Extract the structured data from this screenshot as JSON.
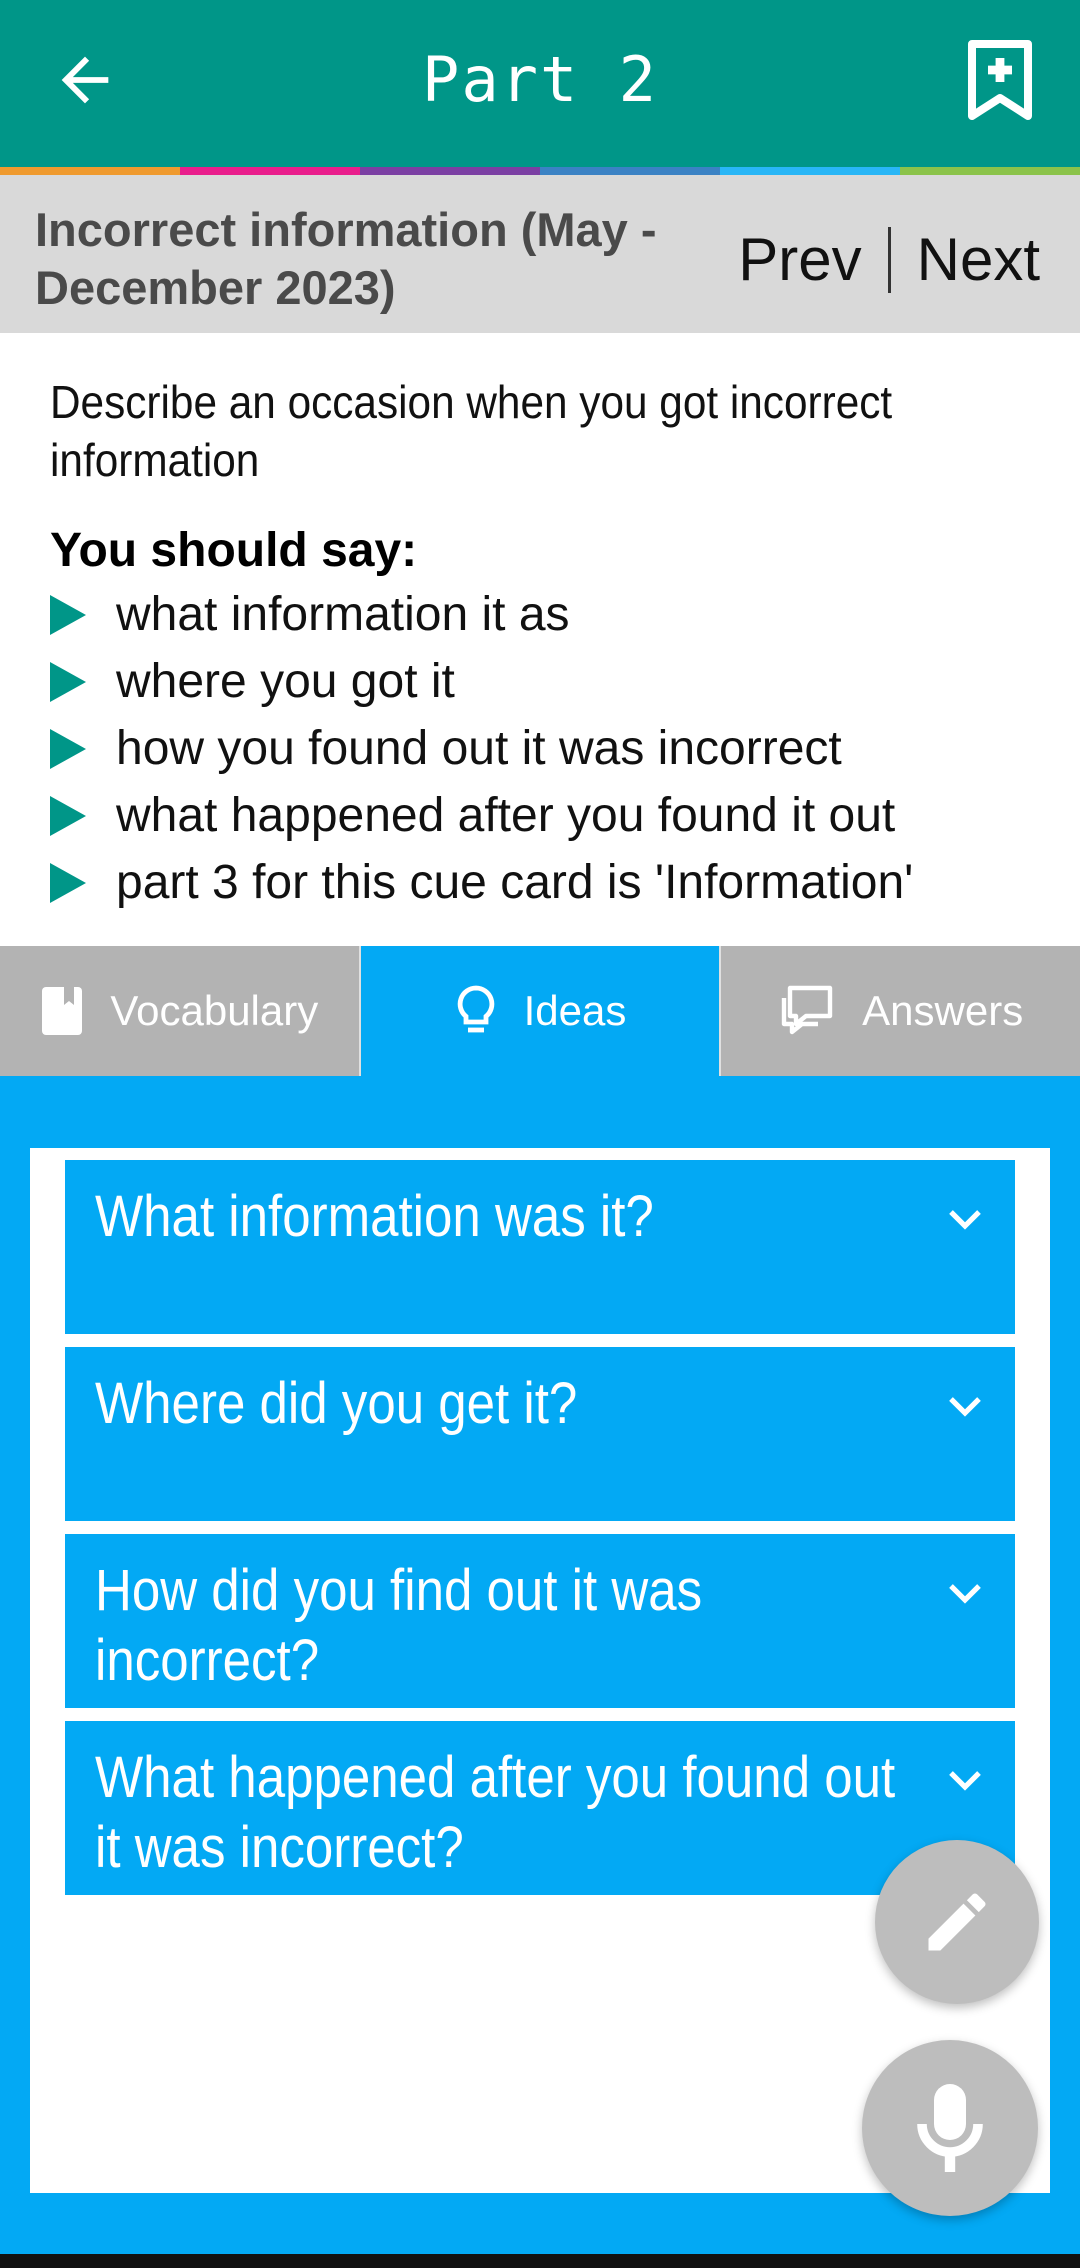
{
  "appbar": {
    "title": "Part 2",
    "back_icon": "arrow-left-icon",
    "bookmark_icon": "bookmark-add-icon",
    "bg_color": "#009688"
  },
  "color_strip": [
    "#ef9a2e",
    "#e91e8c",
    "#7b3fa3",
    "#3b82c4",
    "#29b6f6",
    "#8bc34a"
  ],
  "topic": {
    "title": "Incorrect information (May - December 2023)",
    "prev_label": "Prev",
    "next_label": "Next"
  },
  "cue_card": {
    "title": "Describe an occasion when you got incorrect information",
    "you_should_say": "You should say:",
    "points": [
      "what information it as",
      "where you got it",
      "how you found out it was incorrect",
      "what happened after you found it out",
      "part 3 for this cue card is 'Information'"
    ]
  },
  "tabs": [
    {
      "label": "Vocabulary",
      "icon": "book-icon",
      "active": false
    },
    {
      "label": "Ideas",
      "icon": "lightbulb-icon",
      "active": true
    },
    {
      "label": "Answers",
      "icon": "chat-bubbles-icon",
      "active": false
    }
  ],
  "ideas": [
    {
      "question": "What information was it?"
    },
    {
      "question": "Where did you get it?"
    },
    {
      "question": "How did you find out it was incorrect?"
    },
    {
      "question": "What happened after you found out it was incorrect?"
    }
  ],
  "fabs": {
    "edit_icon": "pencil-icon",
    "mic_icon": "microphone-icon"
  },
  "colors": {
    "accent": "#03a9f4",
    "teal": "#009688",
    "tab_inactive": "#b3b3b3",
    "fab": "#bdbdbd"
  }
}
